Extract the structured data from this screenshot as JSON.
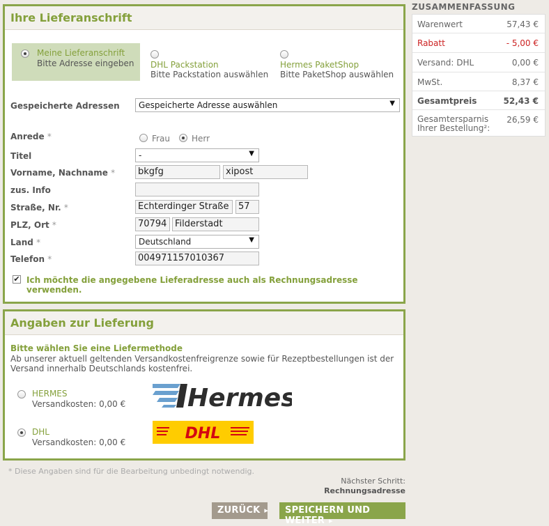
{
  "address": {
    "title": "Ihre Lieferanschrift",
    "options": [
      {
        "main": "Meine Lieferanschrift",
        "sub": "Bitte Adresse eingeben",
        "selected": true
      },
      {
        "main": "DHL Packstation",
        "sub": "Bitte Packstation auswählen",
        "selected": false
      },
      {
        "main": "Hermes PaketShop",
        "sub": "Bitte PaketShop auswählen",
        "selected": false
      }
    ],
    "saved_label": "Gespeicherte Adressen",
    "saved_value": "Gespeicherte Adresse auswählen",
    "salutation_label": "Anrede",
    "salutation_frau": "Frau",
    "salutation_herr": "Herr",
    "title_label": "Titel",
    "title_value": "-",
    "name_label": "Vorname, Nachname",
    "first_name": "bkgfg",
    "last_name": "xipost",
    "info_label": "zus. Info",
    "info_value": "",
    "street_label": "Straße, Nr.",
    "street": "Echterdinger Straße",
    "house_no": "57",
    "zip_label": "PLZ, Ort",
    "zip": "70794",
    "city": "Filderstadt",
    "country_label": "Land",
    "country": "Deutschland",
    "phone_label": "Telefon",
    "phone": "004971157010367",
    "required_mark": "*",
    "billing_checkbox": "Ich möchte die angegebene Lieferadresse auch als Rechnungsadresse verwenden."
  },
  "delivery": {
    "title": "Angaben zur Lieferung",
    "heading": "Bitte wählen Sie eine Liefermethode",
    "note": "Ab unserer aktuell geltenden Versandkostenfreigrenze sowie für Rezeptbestellungen ist der Versand innerhalb Deutschlands kostenfrei.",
    "methods": [
      {
        "name": "HERMES",
        "cost": "Versandkosten: 0,00 €",
        "logo": "Hermes",
        "selected": false
      },
      {
        "name": "DHL",
        "cost": "Versandkosten: 0,00 €",
        "logo": "DHL",
        "selected": true
      }
    ]
  },
  "footer": {
    "required_note": "* Diese Angaben sind für die Bearbeitung unbedingt notwendig.",
    "next_step_label": "Nächster Schritt:",
    "next_step_value": "Rechnungsadresse",
    "back_button": "ZURÜCK",
    "save_button": "SPEICHERN UND WEITER"
  },
  "summary": {
    "title": "ZUSAMMENFASSUNG",
    "rows": [
      {
        "label": "Warenwert",
        "value": "57,43 €"
      },
      {
        "label": "Rabatt",
        "value": "- 5,00 €"
      },
      {
        "label": "Versand: DHL",
        "value": "0,00 €"
      },
      {
        "label": "MwSt.",
        "value": "8,37 €"
      },
      {
        "label": "Gesamtpreis",
        "value": "52,43 €"
      },
      {
        "label": "Gesamtersparnis Ihrer Bestellung²:",
        "value": "26,59 €"
      }
    ]
  },
  "colors": {
    "accent": "#8aa54a",
    "discount": "#cc2222",
    "dhl_yellow": "#ffcc00",
    "dhl_red": "#d40511"
  }
}
